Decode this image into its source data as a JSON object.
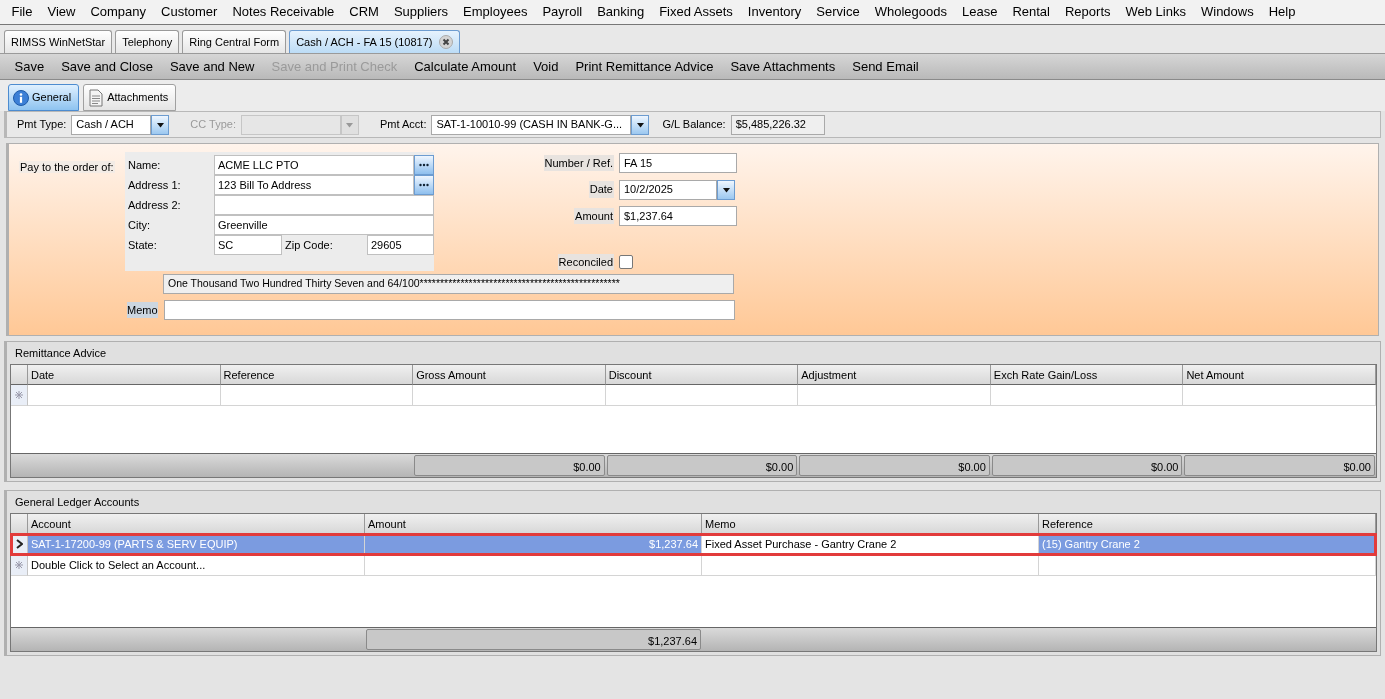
{
  "menu": [
    "File",
    "View",
    "Company",
    "Customer",
    "Notes Receivable",
    "CRM",
    "Suppliers",
    "Employees",
    "Payroll",
    "Banking",
    "Fixed Assets",
    "Inventory",
    "Service",
    "Wholegoods",
    "Lease",
    "Rental",
    "Reports",
    "Web Links",
    "Windows",
    "Help"
  ],
  "doc_tabs": [
    {
      "label": "RIMSS WinNetStar",
      "selected": false
    },
    {
      "label": "Telephony",
      "selected": false
    },
    {
      "label": "Ring Central Form",
      "selected": false
    },
    {
      "label": "Cash / ACH - FA 15 (10817)",
      "selected": true
    }
  ],
  "toolbar": [
    {
      "label": "Save",
      "disabled": false
    },
    {
      "label": "Save and Close",
      "disabled": false
    },
    {
      "label": "Save and New",
      "disabled": false
    },
    {
      "label": "Save and Print Check",
      "disabled": true
    },
    {
      "label": "Calculate Amount",
      "disabled": false
    },
    {
      "label": "Void",
      "disabled": false
    },
    {
      "label": "Print Remittance Advice",
      "disabled": false
    },
    {
      "label": "Save Attachments",
      "disabled": false
    },
    {
      "label": "Send Email",
      "disabled": false
    }
  ],
  "form_tabs": [
    {
      "label": "General",
      "selected": true,
      "kind": "info"
    },
    {
      "label": "Attachments",
      "selected": false,
      "kind": "document"
    }
  ],
  "header": {
    "pmt_type": {
      "label": "Pmt Type:",
      "value": "Cash / ACH"
    },
    "cc_type": {
      "label": "CC Type:",
      "disabled": true
    },
    "pmt_acct": {
      "label": "Pmt Acct:",
      "value": "SAT-1-10010-99 (CASH IN BANK-G..."
    },
    "gl_balance": {
      "label": "G/L Balance:",
      "value": "$5,485,226.32"
    }
  },
  "payee": {
    "label": "Pay to the order of:",
    "fields": [
      {
        "label": "Name:",
        "value": "ACME LLC PTO",
        "lookup": true
      },
      {
        "label": "Address 1:",
        "value": "123 Bill To Address",
        "lookup": true
      },
      {
        "label": "Address 2:",
        "lookup": false
      },
      {
        "label": "City:",
        "value": "Greenville",
        "lookup": false
      }
    ],
    "state": {
      "label": "State:",
      "value": "SC"
    },
    "zip": {
      "label": "Zip Code:",
      "value": "29605"
    }
  },
  "amount_words": "One Thousand Two Hundred Thirty Seven and 64/100*************************************************",
  "memo": {
    "label": "Memo"
  },
  "number_ref": {
    "label": "Number / Ref.",
    "value": "FA 15"
  },
  "date": {
    "label": "Date",
    "value": "10/2/2025"
  },
  "amount": {
    "label": "Amount",
    "value": "$1,237.64"
  },
  "reconciled": {
    "label": "Reconciled",
    "checked": false
  },
  "remittance": {
    "title": "Remittance Advice",
    "columns": [
      {
        "label": "Date"
      },
      {
        "label": "Reference"
      },
      {
        "label": "Gross Amount",
        "total": "$0.00"
      },
      {
        "label": "Discount",
        "total": "$0.00"
      },
      {
        "label": "Adjustment",
        "total": "$0.00"
      },
      {
        "label": "Exch Rate Gain/Loss",
        "total": "$0.00"
      },
      {
        "label": "Net Amount",
        "total": "$0.00"
      }
    ]
  },
  "gl": {
    "title": "General Ledger Accounts",
    "columns": [
      {
        "label": "Account",
        "kind": "text"
      },
      {
        "label": "Amount",
        "kind": "money",
        "total": "$1,237.64"
      },
      {
        "label": "Memo",
        "kind": "text"
      },
      {
        "label": "Reference",
        "kind": "text"
      }
    ],
    "rows": [
      {
        "selected": true,
        "cells": [
          {
            "text": "SAT-1-17200-99 (PARTS & SERV EQUIP)",
            "editing": false
          },
          {
            "text": "$1,237.64",
            "editing": false
          },
          {
            "text": "Fixed Asset Purchase - Gantry Crane 2",
            "editing": true
          },
          {
            "text": "(15) Gantry Crane 2",
            "editing": false
          }
        ]
      }
    ],
    "new_row_hint": "Double Click to Select an Account..."
  }
}
